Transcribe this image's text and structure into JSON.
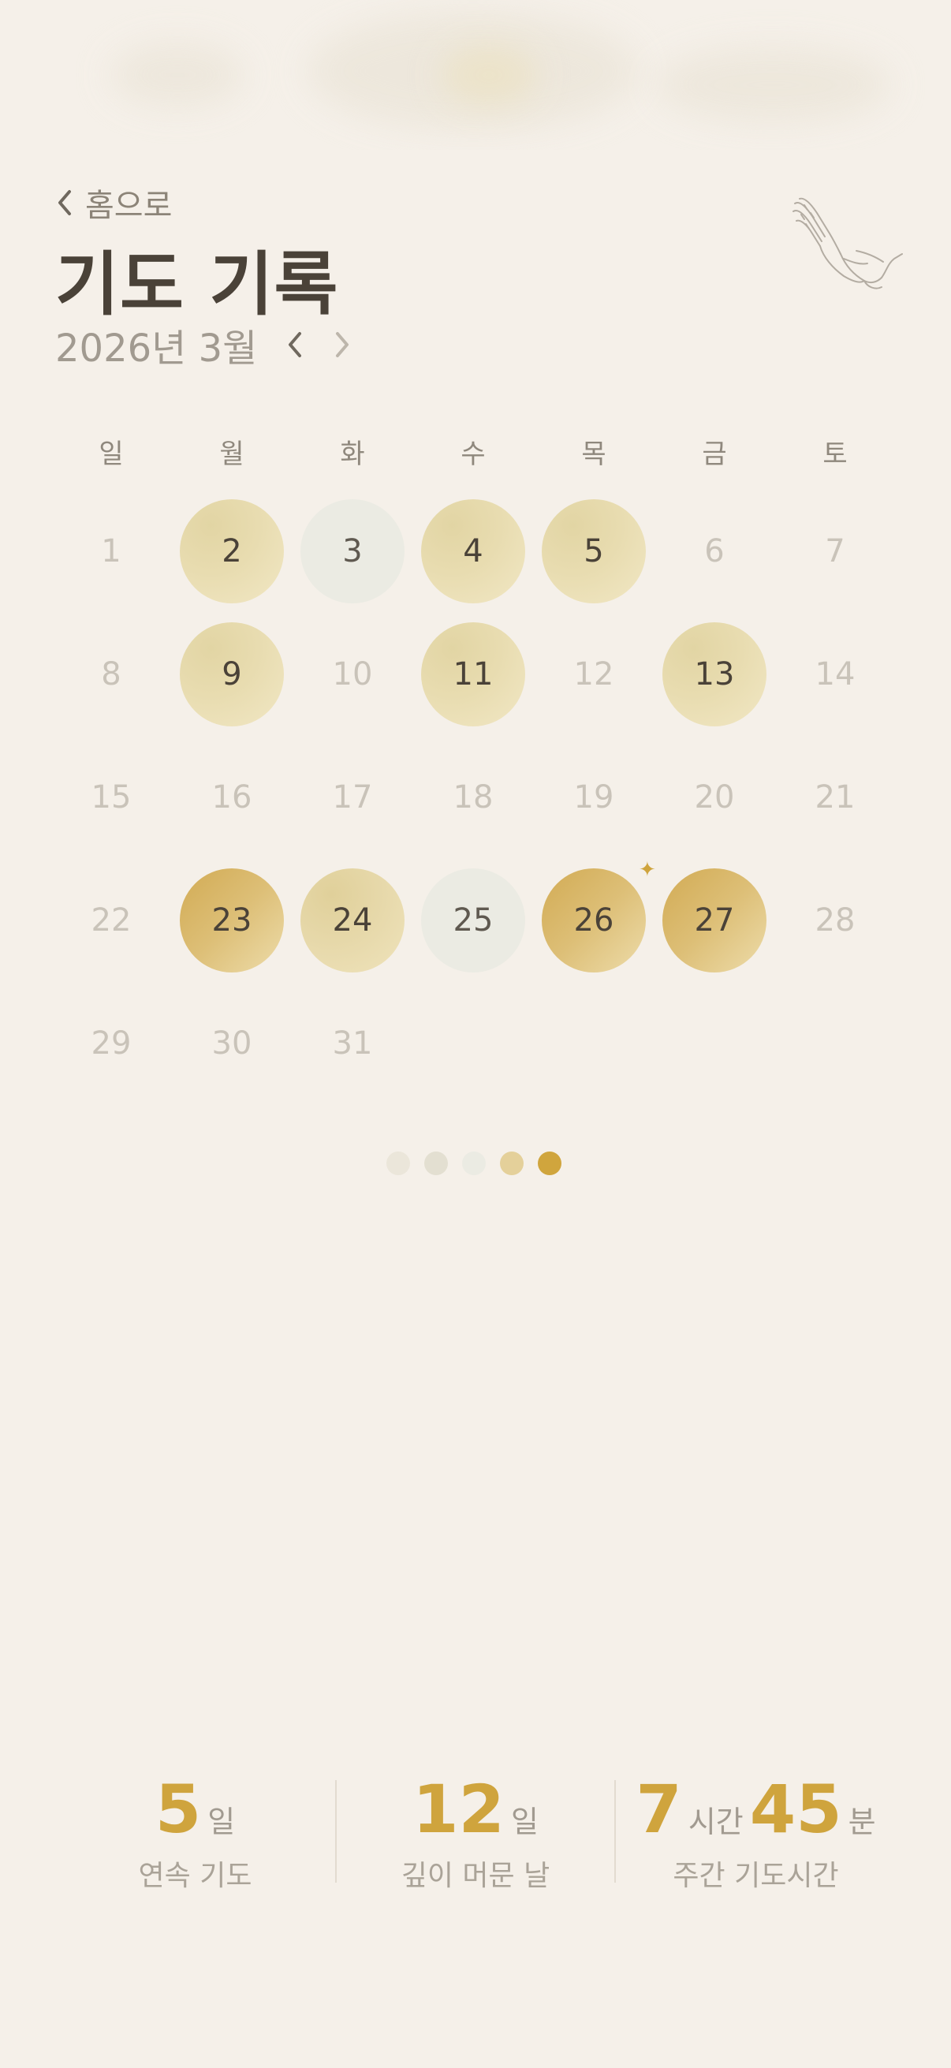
{
  "header": {
    "back_label": "홈으로",
    "title": "기도 기록",
    "month_label": "2026년 3월"
  },
  "calendar": {
    "weekdays": [
      "일",
      "월",
      "화",
      "수",
      "목",
      "금",
      "토"
    ],
    "days": [
      {
        "day": "1",
        "state": "none"
      },
      {
        "day": "2",
        "state": "light"
      },
      {
        "day": "3",
        "state": "gray"
      },
      {
        "day": "4",
        "state": "light"
      },
      {
        "day": "5",
        "state": "light"
      },
      {
        "day": "6",
        "state": "none"
      },
      {
        "day": "7",
        "state": "none"
      },
      {
        "day": "8",
        "state": "none"
      },
      {
        "day": "9",
        "state": "light"
      },
      {
        "day": "10",
        "state": "none"
      },
      {
        "day": "11",
        "state": "light"
      },
      {
        "day": "12",
        "state": "none"
      },
      {
        "day": "13",
        "state": "light"
      },
      {
        "day": "14",
        "state": "none"
      },
      {
        "day": "15",
        "state": "none"
      },
      {
        "day": "16",
        "state": "none"
      },
      {
        "day": "17",
        "state": "none"
      },
      {
        "day": "18",
        "state": "none"
      },
      {
        "day": "19",
        "state": "none"
      },
      {
        "day": "20",
        "state": "none"
      },
      {
        "day": "21",
        "state": "none"
      },
      {
        "day": "22",
        "state": "none"
      },
      {
        "day": "23",
        "state": "gold"
      },
      {
        "day": "24",
        "state": "mid"
      },
      {
        "day": "25",
        "state": "gray"
      },
      {
        "day": "26",
        "state": "gold",
        "highlight": true
      },
      {
        "day": "27",
        "state": "gold"
      },
      {
        "day": "28",
        "state": "none"
      },
      {
        "day": "29",
        "state": "none"
      },
      {
        "day": "30",
        "state": "none"
      },
      {
        "day": "31",
        "state": "none"
      }
    ],
    "sparkle_icon": "sparkle-icon"
  },
  "legend_dots": [
    "#ebe6da",
    "#e3dfd1",
    "#ebebe3",
    "#e4d09a",
    "#d0a53d"
  ],
  "stats": [
    {
      "parts": [
        {
          "value": "5",
          "kind": "big"
        },
        {
          "value": "일",
          "kind": "unit"
        }
      ],
      "caption": "연속 기도"
    },
    {
      "parts": [
        {
          "value": "12",
          "kind": "big"
        },
        {
          "value": "일",
          "kind": "unit"
        }
      ],
      "caption": "깊이 머문 날"
    },
    {
      "parts": [
        {
          "value": "7",
          "kind": "big"
        },
        {
          "value": "시간",
          "kind": "unit"
        },
        {
          "value": "45",
          "kind": "big"
        },
        {
          "value": "분",
          "kind": "unit"
        }
      ],
      "caption": "주간 기도시간"
    }
  ],
  "colors": {
    "accent": "#cfa43d",
    "background": "#f5f0e9",
    "title": "#4a4238"
  }
}
